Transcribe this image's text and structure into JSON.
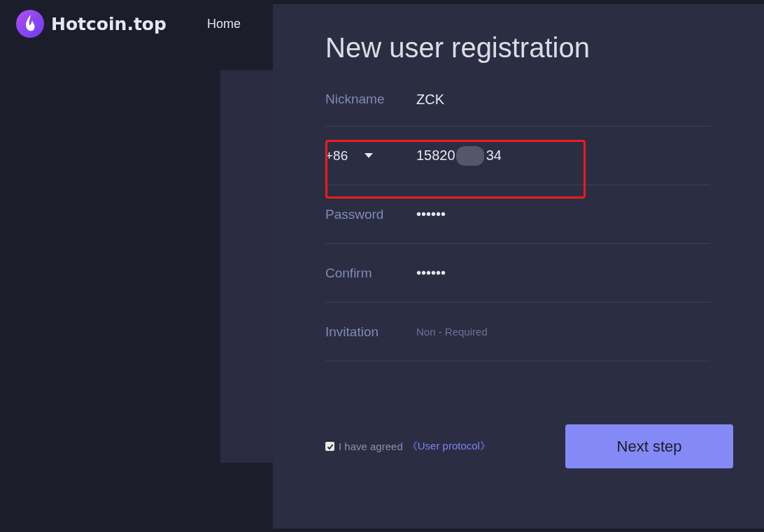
{
  "header": {
    "brand": "Hotcoin.top",
    "nav": [
      {
        "label": "Home"
      }
    ]
  },
  "dialog": {
    "title": "New user registration",
    "fields": [
      {
        "kind": "text",
        "label": "Nickname",
        "value": "ZCK"
      },
      {
        "kind": "phone",
        "prefix": "+86",
        "value_start": "15820",
        "value_end": "34",
        "redacted": true,
        "highlighted": true
      },
      {
        "kind": "text",
        "label": "Password",
        "value": "••••••"
      },
      {
        "kind": "text",
        "label": "Confirm",
        "value": "••••••"
      },
      {
        "kind": "text",
        "label": "Invitation",
        "placeholder": "Non - Required"
      }
    ],
    "agreement": {
      "checked": true,
      "text": "I have agreed",
      "link": "《User protocol》"
    },
    "submit": "Next step"
  }
}
